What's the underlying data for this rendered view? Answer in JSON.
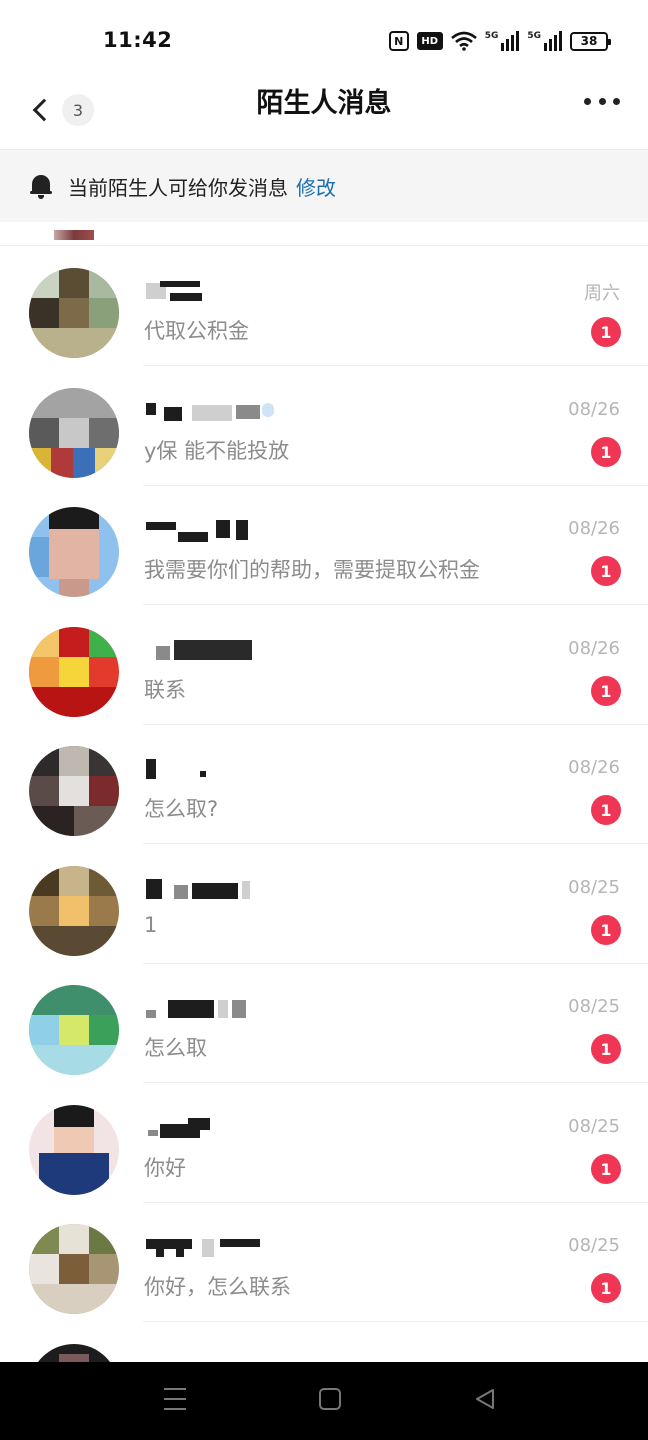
{
  "status_bar": {
    "time": "11:42",
    "icons": [
      "nfc-icon",
      "hd-icon",
      "wifi-icon",
      "5g-signal-icon",
      "5g-signal-icon",
      "battery-icon"
    ],
    "nfc_label": "N",
    "hd_label": "HD",
    "net_label": "5G",
    "battery": "38"
  },
  "nav": {
    "back_count": "3",
    "title": "陌生人消息"
  },
  "notice": {
    "text": "当前陌生人可给你发消息",
    "link": "修改"
  },
  "colors": {
    "badge": "#f03655",
    "link": "#1a6fb3",
    "muted": "#8c8c8c"
  },
  "messages": [
    {
      "message": "代取公积金",
      "date": "周六",
      "unread": "1"
    },
    {
      "message": "y保 能不能投放",
      "date": "08/26",
      "unread": "1"
    },
    {
      "message": "我需要你们的帮助，需要提取公积金",
      "date": "08/26",
      "unread": "1"
    },
    {
      "message": "联系",
      "date": "08/26",
      "unread": "1"
    },
    {
      "message": "怎么取?",
      "date": "08/26",
      "unread": "1"
    },
    {
      "message": "1",
      "date": "08/25",
      "unread": "1"
    },
    {
      "message": "怎么取",
      "date": "08/25",
      "unread": "1"
    },
    {
      "message": "你好",
      "date": "08/25",
      "unread": "1"
    },
    {
      "message": "你好，怎么联系",
      "date": "08/25",
      "unread": "1"
    }
  ]
}
